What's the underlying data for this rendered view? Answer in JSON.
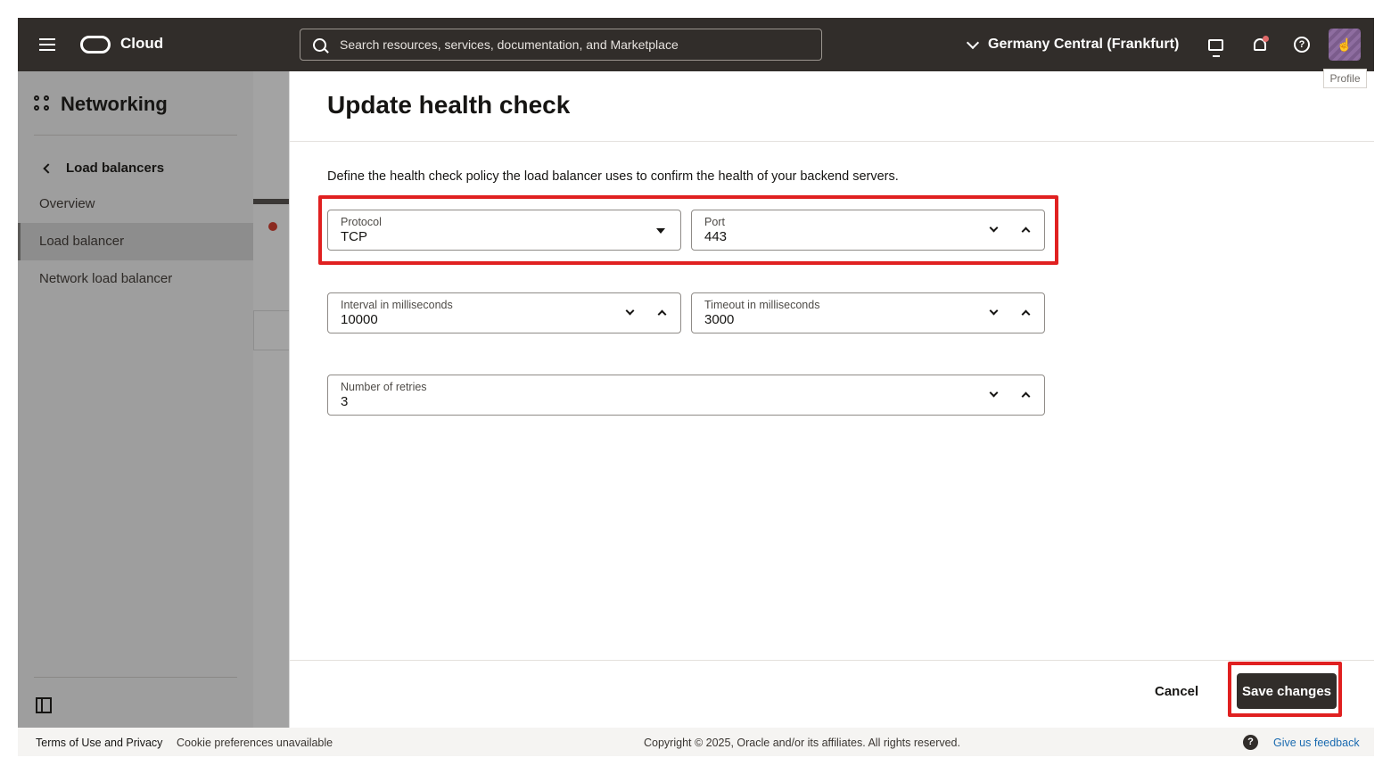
{
  "header": {
    "brand": "Cloud",
    "search_placeholder": "Search resources, services, documentation, and Marketplace",
    "region": "Germany Central (Frankfurt)",
    "profile_tooltip": "Profile"
  },
  "sidebar": {
    "title": "Networking",
    "back_label": "Load balancers",
    "items": [
      {
        "label": "Overview"
      },
      {
        "label": "Load balancer"
      },
      {
        "label": "Network load balancer"
      }
    ]
  },
  "drawer": {
    "title": "Update health check",
    "description": "Define the health check policy the load balancer uses to confirm the health of your backend servers.",
    "protocol": {
      "label": "Protocol",
      "value": "TCP"
    },
    "port": {
      "label": "Port",
      "value": "443"
    },
    "interval": {
      "label": "Interval in milliseconds",
      "value": "10000"
    },
    "timeout": {
      "label": "Timeout in milliseconds",
      "value": "3000"
    },
    "retries": {
      "label": "Number of retries",
      "value": "3"
    },
    "cancel_label": "Cancel",
    "save_label": "Save changes"
  },
  "footer": {
    "terms": "Terms of Use and Privacy",
    "cookies": "Cookie preferences unavailable",
    "copyright": "Copyright © 2025, Oracle and/or its affiliates. All rights reserved.",
    "feedback": "Give us feedback"
  },
  "colors": {
    "topbar": "#312d2a",
    "highlight": "#e02020",
    "link": "#1b6bb0"
  }
}
